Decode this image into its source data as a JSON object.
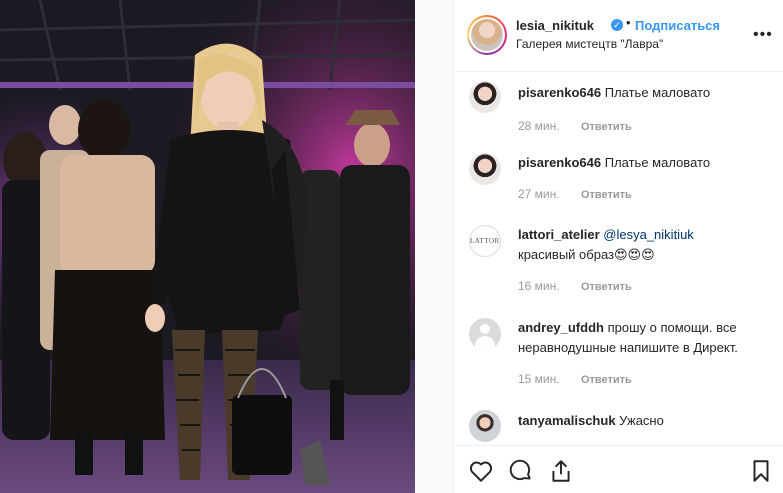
{
  "post": {
    "photo_alt": "photo",
    "author": {
      "username": "lesia_nikituk",
      "verified": true,
      "follow_label": "Подписаться",
      "separator": "•",
      "location": "Галерея мистецтв \"Лавра\""
    },
    "more_label": "•••"
  },
  "comments": [
    {
      "username": "pisarenko646",
      "text": "Платье маловато",
      "time": "28 мин.",
      "reply_label": "Ответить",
      "avatar": "girl"
    },
    {
      "username": "pisarenko646",
      "text": "Платье маловато",
      "time": "27 мин.",
      "reply_label": "Ответить",
      "avatar": "girl"
    },
    {
      "username": "lattori_atelier",
      "mention": "@lesya_nikitiuk",
      "text_line2": "красивый образ😍😍😍",
      "time": "16 мин.",
      "reply_label": "Ответить",
      "avatar": "lattori",
      "avatar_text": "LATTORI"
    },
    {
      "username": "andrey_ufddh",
      "text": "прошу о помощи. все неравнодушные напишите в Директ.",
      "time": "15 мин.",
      "reply_label": "Ответить",
      "avatar": "generic"
    },
    {
      "username": "tanyamalischuk",
      "text": "Ужасно",
      "avatar": "tanya"
    }
  ],
  "actions": {
    "like_icon": "heart-icon",
    "comment_icon": "comment-icon",
    "share_icon": "share-icon",
    "save_icon": "bookmark-icon"
  },
  "colors": {
    "accent": "#3897f0",
    "text": "#262626",
    "muted": "#999999",
    "border": "#efefef"
  }
}
